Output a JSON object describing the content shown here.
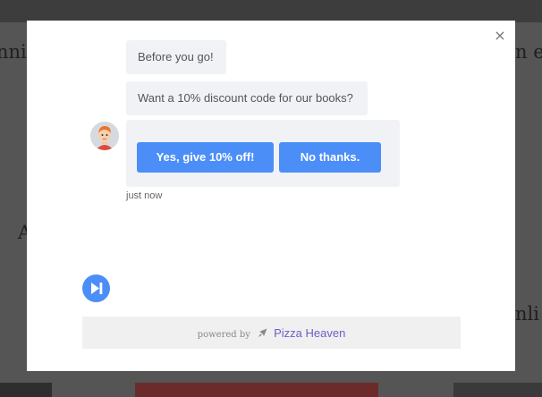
{
  "background": {
    "text_left_top": "nni",
    "text_right_top": "n e",
    "text_left_mid": "A",
    "text_right_mid": "nli"
  },
  "modal": {
    "close_label": "×",
    "messages": [
      {
        "text": "Before you go!"
      },
      {
        "text": "Want a 10% discount code for our books?"
      }
    ],
    "buttons": {
      "yes_label": "Yes, give 10% off!",
      "no_label": "No thanks."
    },
    "timestamp": "just now",
    "footer": {
      "powered_by": "powered by",
      "brand": "Pizza Heaven"
    }
  },
  "colors": {
    "accent": "#4c8ef7",
    "bubble": "#f1f2f6",
    "brand": "#6a5fc8"
  }
}
